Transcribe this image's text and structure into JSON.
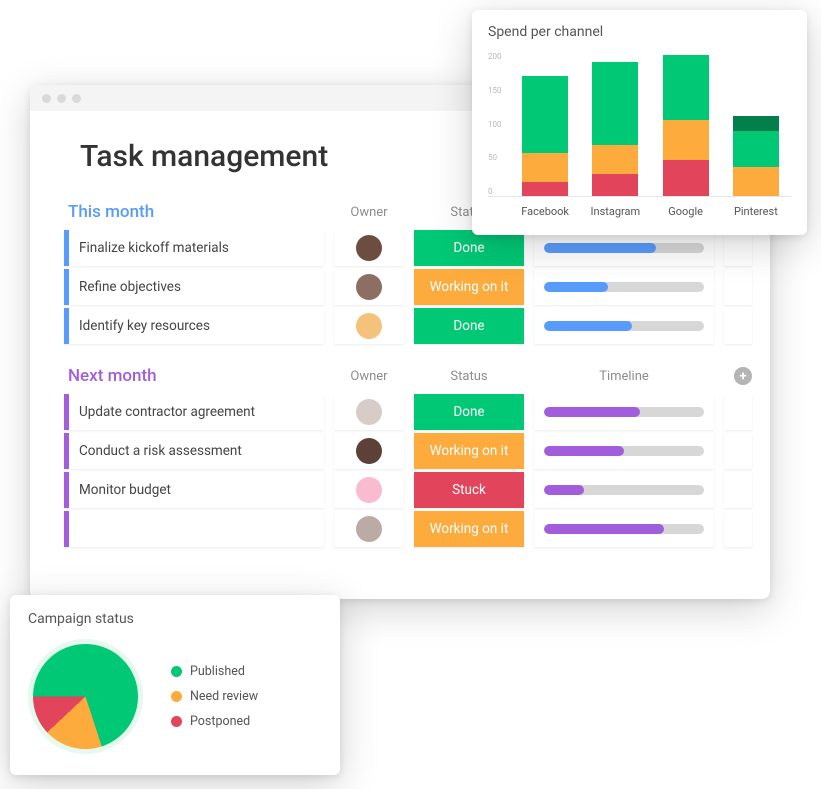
{
  "colors": {
    "green": "#00c875",
    "orange": "#fdab3d",
    "red": "#e2445c",
    "darkgreen": "#037f4c",
    "blue": "#579bfc",
    "purple": "#a25ddc"
  },
  "page_title": "Task management",
  "column_labels": {
    "owner": "Owner",
    "status": "Status",
    "timeline": "Timeline"
  },
  "status_labels": {
    "done": "Done",
    "working": "Working on it",
    "stuck": "Stuck"
  },
  "sections": [
    {
      "title": "This month",
      "accent": "#579bfc",
      "rows": [
        {
          "task": "Finalize kickoff materials",
          "avatar_bg": "#6d4c41",
          "status": "done",
          "progress": 70
        },
        {
          "task": "Refine objectives",
          "avatar_bg": "#8d6e63",
          "status": "working",
          "progress": 40
        },
        {
          "task": "Identify key resources",
          "avatar_bg": "#f4c27a",
          "status": "done",
          "progress": 55
        }
      ]
    },
    {
      "title": "Next month",
      "accent": "#a25ddc",
      "rows": [
        {
          "task": "Update contractor agreement",
          "avatar_bg": "#d7ccc8",
          "status": "done",
          "progress": 60
        },
        {
          "task": "Conduct a risk assessment",
          "avatar_bg": "#5d4037",
          "status": "working",
          "progress": 50
        },
        {
          "task": "Monitor budget",
          "avatar_bg": "#f8bbd0",
          "status": "stuck",
          "progress": 25
        },
        {
          "task": "",
          "avatar_bg": "#bcaaa4",
          "status": "working",
          "progress": 75
        }
      ]
    }
  ],
  "chart_data": [
    {
      "type": "bar_stacked",
      "title": "Spend per channel",
      "ylim": [
        0,
        200
      ],
      "yticks": [
        0,
        50,
        100,
        150,
        200
      ],
      "categories": [
        "Facebook",
        "Instagram",
        "Google",
        "Pinterest"
      ],
      "stack_order": [
        "red",
        "orange",
        "green",
        "darkgreen"
      ],
      "stack_colors": {
        "red": "#e2445c",
        "orange": "#fdab3d",
        "green": "#00c875",
        "darkgreen": "#037f4c"
      },
      "series": [
        {
          "name": "red",
          "values": [
            20,
            30,
            50,
            0
          ]
        },
        {
          "name": "orange",
          "values": [
            40,
            40,
            55,
            40
          ]
        },
        {
          "name": "green",
          "values": [
            105,
            115,
            90,
            50
          ]
        },
        {
          "name": "darkgreen",
          "values": [
            0,
            0,
            0,
            20
          ]
        }
      ]
    },
    {
      "type": "pie",
      "title": "Campaign status",
      "series": [
        {
          "name": "Published",
          "value": 70,
          "color": "#00c875"
        },
        {
          "name": "Need review",
          "value": 18,
          "color": "#fdab3d"
        },
        {
          "name": "Postponed",
          "value": 12,
          "color": "#e2445c"
        }
      ]
    }
  ]
}
